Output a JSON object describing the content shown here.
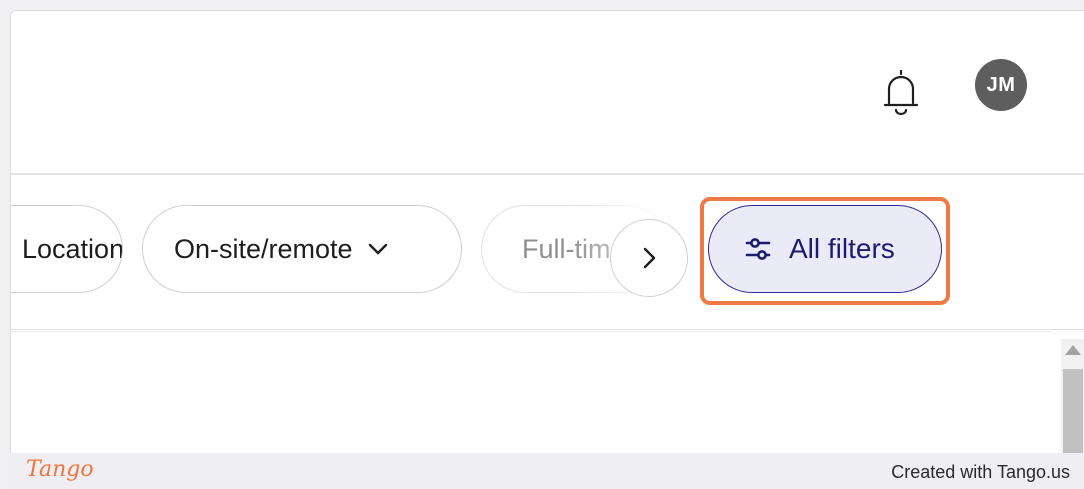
{
  "header": {
    "avatar_initials": "JM"
  },
  "filters": {
    "chips": [
      {
        "label": "Location"
      },
      {
        "label": "On-site/remote"
      },
      {
        "label": "Full-time"
      }
    ],
    "all_filters_label": "All filters"
  },
  "footer": {
    "logo_text": "Tango",
    "credit": "Created with Tango.us"
  },
  "colors": {
    "highlight": "#f07a45",
    "all_filters_border": "#2b2a9a",
    "all_filters_bg": "#ebebf8",
    "avatar_bg": "#5e5e5e",
    "tango_brand": "#f0753e"
  },
  "icons": {
    "notifications": "bell-icon",
    "onsite_dropdown": "chevron-down-icon",
    "scroll_right": "chevron-right-icon",
    "all_filters": "sliders-icon"
  }
}
